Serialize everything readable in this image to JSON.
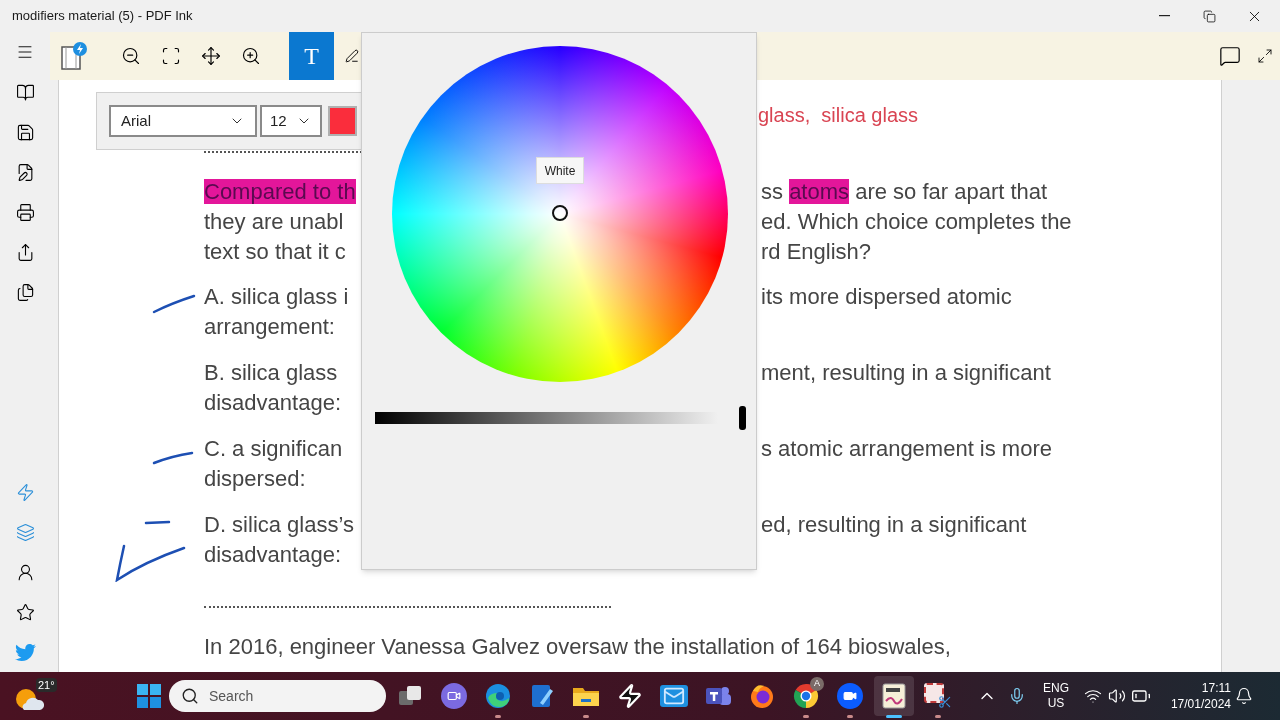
{
  "window": {
    "title": "modifiers material (5) - PDF Ink"
  },
  "toolbar": {
    "text_tool": {
      "label": "T",
      "selected": true
    }
  },
  "font_bar": {
    "font": "Arial",
    "size": "12",
    "color": "#fa2d3c"
  },
  "document": {
    "note": "glass,  silica glass",
    "question": [
      {
        "left": [
          {
            "text": "Compared to th",
            "highlighted": true
          }
        ],
        "right": [
          {
            "text": "ss ",
            "highlighted": false
          },
          {
            "text": "atoms",
            "highlighted": true
          },
          {
            "text": " are so far apart that",
            "highlighted": false
          }
        ]
      },
      {
        "left": [
          {
            "text": "they are unabl",
            "highlighted": false
          }
        ],
        "right": [
          {
            "text": "ed. Which choice completes the",
            "highlighted": false
          }
        ]
      },
      {
        "left": [
          {
            "text": "text so that it c",
            "highlighted": false
          }
        ],
        "right": [
          {
            "text": "rd English?",
            "highlighted": false
          }
        ]
      }
    ],
    "options": [
      {
        "kind": "stroke",
        "lines": [
          {
            "left": [
              {
                "text": "A. silica glass i",
                "highlighted": false
              }
            ],
            "right": [
              {
                "text": "its more dispersed atomic",
                "highlighted": false
              }
            ]
          },
          {
            "left": [
              {
                "text": "arrangement:",
                "highlighted": false
              }
            ]
          }
        ]
      },
      {
        "kind": "unmarked",
        "lines": [
          {
            "left": [
              {
                "text": "B. silica glass",
                "highlighted": false
              }
            ],
            "right": [
              {
                "text": "ment, resulting in a significant",
                "highlighted": false
              }
            ]
          },
          {
            "left": [
              {
                "text": "disadvantage:",
                "highlighted": false
              }
            ]
          }
        ]
      },
      {
        "kind": "dash",
        "lines": [
          {
            "left": [
              {
                "text": "C. a significan",
                "highlighted": false
              }
            ],
            "right": [
              {
                "text": "s atomic arrangement is more",
                "highlighted": false
              }
            ]
          },
          {
            "left": [
              {
                "text": "dispersed:",
                "highlighted": false
              }
            ]
          }
        ]
      },
      {
        "kind": "check",
        "lines": [
          {
            "left": [
              {
                "text": "D. silica glass’s",
                "highlighted": false
              }
            ],
            "right": [
              {
                "text": "ed, resulting in a significant",
                "highlighted": false
              }
            ]
          },
          {
            "left": [
              {
                "text": "disadvantage:",
                "highlighted": false
              }
            ]
          }
        ]
      }
    ],
    "passage": "In 2016, engineer Vanessa Galvez oversaw the installation of 164 bioswales,"
  },
  "color_picker": {
    "tooltip": "White",
    "level": 1
  },
  "taskbar": {
    "weather": "21°",
    "search": {
      "placeholder": "Search"
    },
    "apps": [
      {
        "kind": "task-view",
        "running": false,
        "selected": false
      },
      {
        "kind": "chat",
        "running": false,
        "selected": false
      },
      {
        "kind": "edge",
        "running": true,
        "selected": false
      },
      {
        "kind": "pen",
        "running": false,
        "selected": false
      },
      {
        "kind": "folder",
        "running": true,
        "selected": false
      },
      {
        "kind": "bolt",
        "running": false,
        "selected": false
      },
      {
        "kind": "mail",
        "running": false,
        "selected": false
      },
      {
        "kind": "teams",
        "running": false,
        "selected": false
      },
      {
        "kind": "firefox",
        "running": false,
        "selected": false
      },
      {
        "kind": "chrome",
        "running": true,
        "selected": false,
        "badge": "A"
      },
      {
        "kind": "zoom",
        "running": true,
        "selected": false
      },
      {
        "kind": "pdf",
        "running": true,
        "selected": true
      },
      {
        "kind": "snip",
        "running": true,
        "selected": false
      }
    ],
    "language": [
      "ENG",
      "US"
    ],
    "time": "17:11",
    "date": "17/01/2024"
  }
}
